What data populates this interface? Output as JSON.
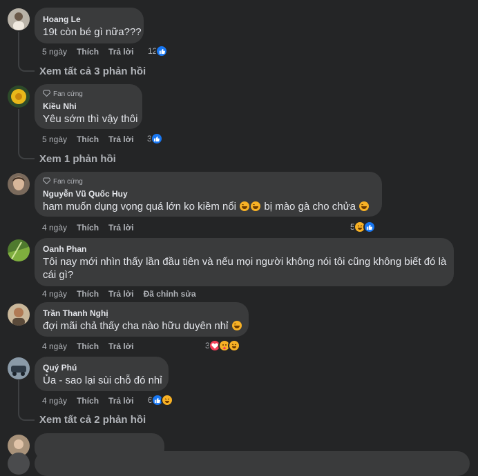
{
  "comments": [
    {
      "name": "Hoang Le",
      "badge": "",
      "text": "19t còn bé gì nữa???",
      "time": "5 ngày",
      "like_label": "Thích",
      "reply_label": "Trả lời",
      "edited": "",
      "reaction_count": "12",
      "reactions": [
        "like"
      ],
      "replies_link": "Xem tất cả 3 phản hồi"
    },
    {
      "name": "Kiều Nhi",
      "badge": "Fan cứng",
      "text": "Yêu sớm thì vậy thôi",
      "time": "5 ngày",
      "like_label": "Thích",
      "reply_label": "Trả lời",
      "edited": "",
      "reaction_count": "3",
      "reactions": [
        "like"
      ],
      "replies_link": "Xem 1 phản hồi"
    },
    {
      "name": "Nguyễn Vũ Quốc Huy",
      "badge": "Fan cứng",
      "text_parts": [
        "ham muốn dụng vọng quá lớn ko kiềm nổi",
        "bị mào gà cho chửa"
      ],
      "time": "4 ngày",
      "like_label": "Thích",
      "reply_label": "Trả lời",
      "edited": "",
      "reaction_count": "5",
      "reactions": [
        "haha",
        "like"
      ]
    },
    {
      "name": "Oanh Phan",
      "badge": "",
      "text": "Tôi nay mới nhìn thấy lần đầu tiên và nếu mọi người không nói tôi cũng không biết đó là cái gì?",
      "time": "4 ngày",
      "like_label": "Thích",
      "reply_label": "Trả lời",
      "edited": "Đã chỉnh sửa"
    },
    {
      "name": "Trần Thanh Nghị",
      "badge": "",
      "text": "đợi mãi chả thấy cha nào hữu duyên nhỉ",
      "time": "4 ngày",
      "like_label": "Thích",
      "reply_label": "Trả lời",
      "edited": "",
      "reaction_count": "3",
      "reactions": [
        "heart",
        "care",
        "haha"
      ]
    },
    {
      "name": "Quý Phú",
      "badge": "",
      "text": "Ủa - sao lại sùi chỗ đó nhỉ",
      "time": "4 ngày",
      "like_label": "Thích",
      "reply_label": "Trả lời",
      "edited": "",
      "reaction_count": "6",
      "reactions": [
        "like",
        "haha"
      ],
      "replies_link": "Xem tất cả 2 phản hồi"
    }
  ],
  "colors": {
    "background": "#242526",
    "bubble": "#3a3b3c",
    "primary_text": "#e4e6eb",
    "secondary_text": "#b0b3b8",
    "like": "#1877f2",
    "haha": "#f7b125",
    "heart": "#f33e58"
  }
}
